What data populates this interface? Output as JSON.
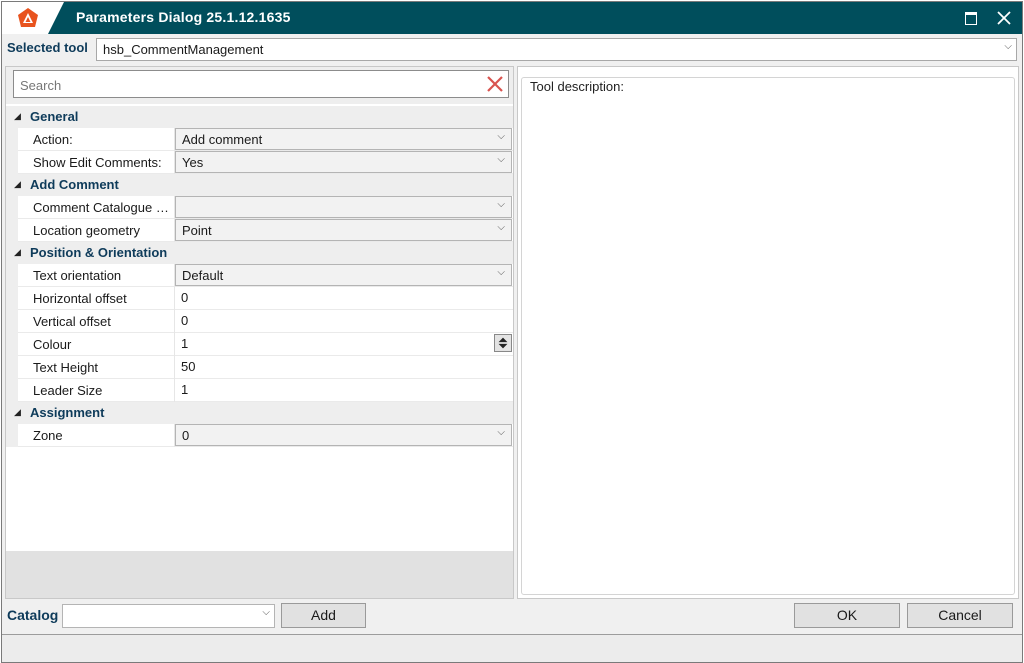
{
  "window": {
    "title": "Parameters Dialog 25.1.12.1635",
    "logo_icon": "hsb-logo-icon",
    "maximize_icon": "maximize-icon",
    "close_icon": "close-icon",
    "title_bar_color": "#004e5c"
  },
  "selected_tool": {
    "label": "Selected tool",
    "value": "hsb_CommentManagement"
  },
  "search": {
    "placeholder": "Search",
    "value": "",
    "clear_icon": "clear-x-icon"
  },
  "categories": [
    {
      "label": "General",
      "props": [
        {
          "name": "Action:",
          "value": "Add comment",
          "kind": "dropdown"
        },
        {
          "name": "Show Edit Comments:",
          "value": "Yes",
          "kind": "dropdown"
        }
      ]
    },
    {
      "label": "Add Comment",
      "props": [
        {
          "name": "Comment Catalogue E...",
          "value": "",
          "kind": "dropdown"
        },
        {
          "name": "Location geometry",
          "value": "Point",
          "kind": "dropdown"
        }
      ]
    },
    {
      "label": "Position & Orientation",
      "props": [
        {
          "name": "Text orientation",
          "value": "Default",
          "kind": "dropdown"
        },
        {
          "name": "Horizontal offset",
          "value": "0",
          "kind": "text"
        },
        {
          "name": "Vertical offset",
          "value": "0",
          "kind": "text"
        },
        {
          "name": "Colour",
          "value": "1",
          "kind": "spinner"
        },
        {
          "name": "Text Height",
          "value": "50",
          "kind": "text"
        },
        {
          "name": "Leader Size",
          "value": "1",
          "kind": "text"
        }
      ]
    },
    {
      "label": "Assignment",
      "props": [
        {
          "name": "Zone",
          "value": "0",
          "kind": "dropdown"
        }
      ]
    }
  ],
  "description": {
    "label": "Tool description:"
  },
  "footer": {
    "catalog_label": "Catalog",
    "catalog_value": "",
    "add_label": "Add",
    "ok_label": "OK",
    "cancel_label": "Cancel"
  }
}
